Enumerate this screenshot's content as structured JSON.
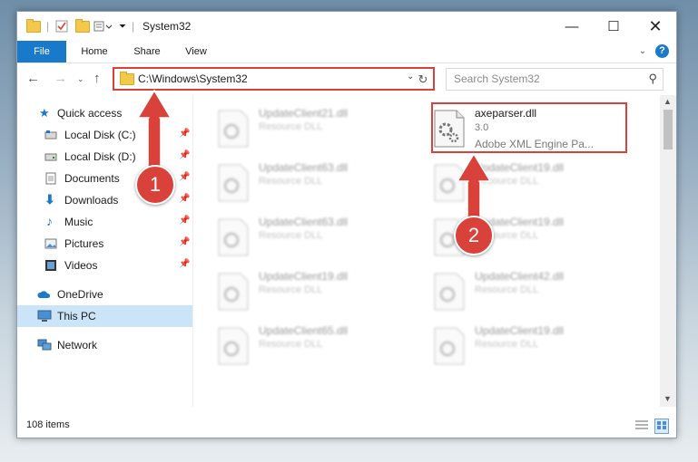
{
  "window": {
    "title": "System32"
  },
  "ribbon": {
    "tabs": [
      "File",
      "Home",
      "Share",
      "View"
    ]
  },
  "address": {
    "path": "C:\\Windows\\System32"
  },
  "search": {
    "placeholder": "Search System32"
  },
  "sidebar": {
    "items": [
      {
        "label": "Quick access"
      },
      {
        "label": "Local Disk (C:)"
      },
      {
        "label": "Local Disk (D:)"
      },
      {
        "label": "Documents"
      },
      {
        "label": "Downloads"
      },
      {
        "label": "Music"
      },
      {
        "label": "Pictures"
      },
      {
        "label": "Videos"
      },
      {
        "label": "OneDrive"
      },
      {
        "label": "This PC"
      },
      {
        "label": "Network"
      }
    ]
  },
  "files": {
    "highlighted": {
      "name": "axeparser.dll",
      "version": "3.0",
      "description": "Adobe XML Engine Pa..."
    },
    "left": [
      {
        "name": "UpdateClient21.dll",
        "type": "Resource DLL"
      },
      {
        "name": "UpdateClient63.dll",
        "type": "Resource DLL"
      },
      {
        "name": "UpdateClient63.dll",
        "type": "Resource DLL"
      },
      {
        "name": "UpdateClient19.dll",
        "type": "Resource DLL"
      },
      {
        "name": "UpdateClient65.dll",
        "type": "Resource DLL"
      }
    ],
    "right": [
      {
        "name": "UpdateClient19.dll",
        "type": "Resource DLL"
      },
      {
        "name": "UpdateClient19.dll",
        "type": "Resource DLL"
      },
      {
        "name": "UpdateClient42.dll",
        "type": "Resource DLL"
      },
      {
        "name": "UpdateClient19.dll",
        "type": "Resource DLL"
      }
    ]
  },
  "status": {
    "items_count": "108 items"
  },
  "callouts": [
    "1",
    "2"
  ],
  "colors": {
    "accent": "#1979ca",
    "highlight": "#d9413b",
    "selection": "#cce4f7"
  }
}
